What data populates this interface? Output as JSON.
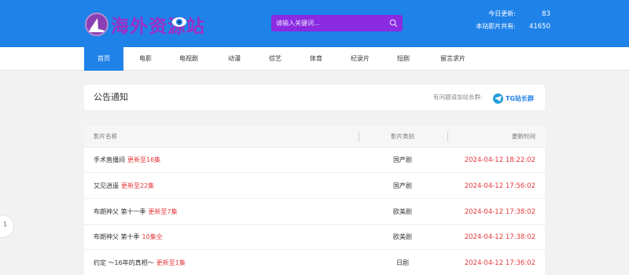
{
  "header": {
    "site_name": "海外资源站",
    "search": {
      "placeholder": "请输入关键词..."
    },
    "stats": [
      {
        "label": "今日更新:",
        "value": "83"
      },
      {
        "label": "本站影片共有:",
        "value": "41650"
      }
    ]
  },
  "nav": {
    "items": [
      {
        "label": "首页",
        "active": true
      },
      {
        "label": "电影"
      },
      {
        "label": "电视剧"
      },
      {
        "label": "动漫"
      },
      {
        "label": "综艺"
      },
      {
        "label": "体育"
      },
      {
        "label": "纪录片"
      },
      {
        "label": "短剧"
      },
      {
        "label": "留言求片"
      }
    ]
  },
  "notice": {
    "title": "公告通知",
    "hint": "有问题请加站长群:",
    "tg_label": "TG站长群"
  },
  "table": {
    "columns": [
      "影片名称",
      "影片类别",
      "更新时间"
    ],
    "rows": [
      {
        "name": "手术直播间",
        "update": "更新至16集",
        "category": "国产剧",
        "time": "2024-04-12 18:22:02"
      },
      {
        "name": "又见逍遥",
        "update": "更新至22集",
        "category": "国产剧",
        "time": "2024-04-12 17:56:02"
      },
      {
        "name": "布朗神父 第十一季",
        "update": "更新至7集",
        "category": "欧美剧",
        "time": "2024-04-12 17:38:02"
      },
      {
        "name": "布朗神父 第十季",
        "update": "10集全",
        "category": "欧美剧",
        "time": "2024-04-12 17:38:02"
      },
      {
        "name": "约定 ～16年的真相～",
        "update": "更新至1集",
        "category": "日剧",
        "time": "2024-04-12 17:36:02"
      }
    ]
  },
  "pager": {
    "current": "1"
  },
  "colors": {
    "header": "#1f82e8",
    "search": "#8a2be2",
    "accent_red": "#e4393c"
  }
}
